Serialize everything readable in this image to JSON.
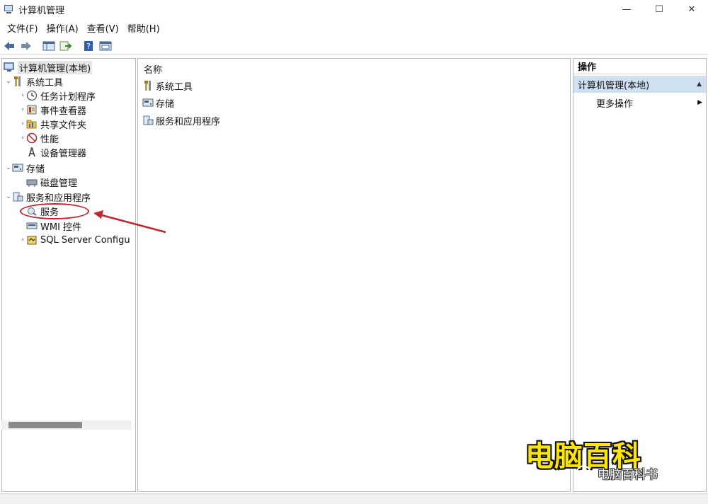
{
  "window": {
    "title": "计算机管理",
    "icon": "computer-management-icon",
    "controls": [
      "—",
      "☐",
      "✕"
    ]
  },
  "menubar": {
    "items": [
      "文件(F)",
      "操作(A)",
      "查看(V)",
      "帮助(H)"
    ]
  },
  "toolbar": {
    "icons": [
      "back-arrow-icon",
      "forward-arrow-icon",
      "show-hide-tree-icon",
      "export-list-icon",
      "help-icon",
      "properties-icon"
    ]
  },
  "tree": {
    "root": "计算机管理(本地)",
    "items": [
      {
        "label": "系统工具",
        "icon": "tools-icon",
        "expander": "⌄"
      },
      {
        "label": "任务计划程序",
        "icon": "clock-icon",
        "expander": "›"
      },
      {
        "label": "事件查看器",
        "icon": "event-viewer-icon",
        "expander": "›"
      },
      {
        "label": "共享文件夹",
        "icon": "shared-folder-icon",
        "expander": "›"
      },
      {
        "label": "性能",
        "icon": "performance-icon",
        "expander": "›"
      },
      {
        "label": "设备管理器",
        "icon": "device-manager-icon",
        "expander": ""
      },
      {
        "label": "存储",
        "icon": "storage-icon",
        "expander": "⌄"
      },
      {
        "label": "磁盘管理",
        "icon": "disk-icon",
        "expander": ""
      },
      {
        "label": "服务和应用程序",
        "icon": "services-apps-icon",
        "expander": "⌄"
      },
      {
        "label": "服务",
        "icon": "services-icon",
        "expander": ""
      },
      {
        "label": "WMI 控件",
        "icon": "wmi-icon",
        "expander": ""
      },
      {
        "label": "SQL Server Configu",
        "icon": "sql-server-icon",
        "expander": "›"
      }
    ]
  },
  "center": {
    "column_header": "名称",
    "items": [
      {
        "label": "系统工具",
        "icon": "tools-icon"
      },
      {
        "label": "存储",
        "icon": "storage-icon"
      },
      {
        "label": "服务和应用程序",
        "icon": "services-apps-icon"
      }
    ]
  },
  "actions": {
    "header": "操作",
    "section": "计算机管理(本地)",
    "more": "更多操作"
  },
  "watermark": {
    "big": "电脑百科",
    "small": "电脑百科书"
  },
  "colors": {
    "annotation_red": "#c0262d",
    "selected_blue": "#cfe0f3",
    "watermark_yellow": "#ffe600"
  }
}
